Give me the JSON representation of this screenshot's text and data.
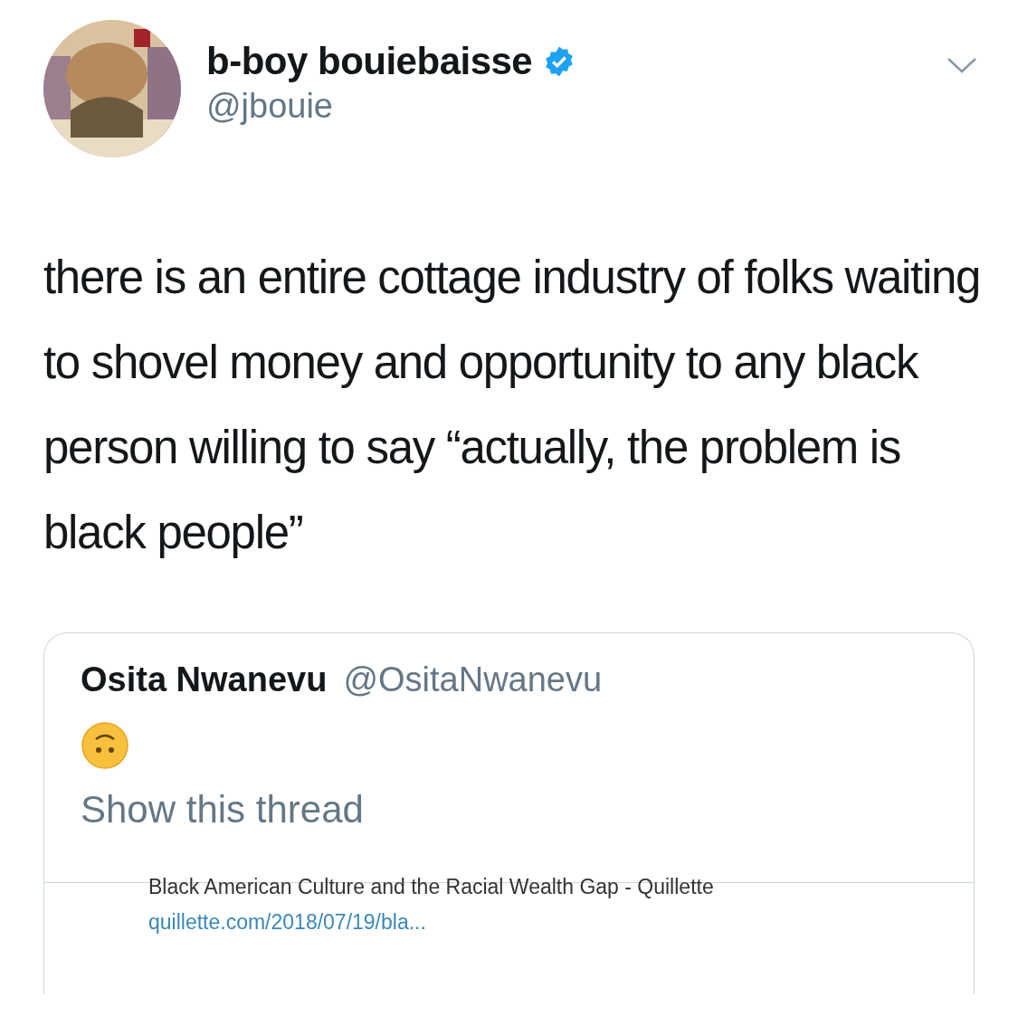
{
  "tweet": {
    "author": {
      "name": "b-boy bouiebaisse",
      "handle": "@jbouie",
      "verified": true
    },
    "text": "there is an entire cottage industry of folks waiting to shovel money and opportunity to any black person willing to say “actually, the problem is black people”",
    "quoted_tweet": {
      "author": {
        "name": "Osita Nwanevu",
        "handle": "@OsitaNwanevu"
      },
      "show_thread": "Show this thread",
      "link_card": {
        "title": "Black American Culture and the Racial Wealth Gap - Quillette",
        "url": "quillette.com/2018/07/19/bla..."
      }
    }
  }
}
